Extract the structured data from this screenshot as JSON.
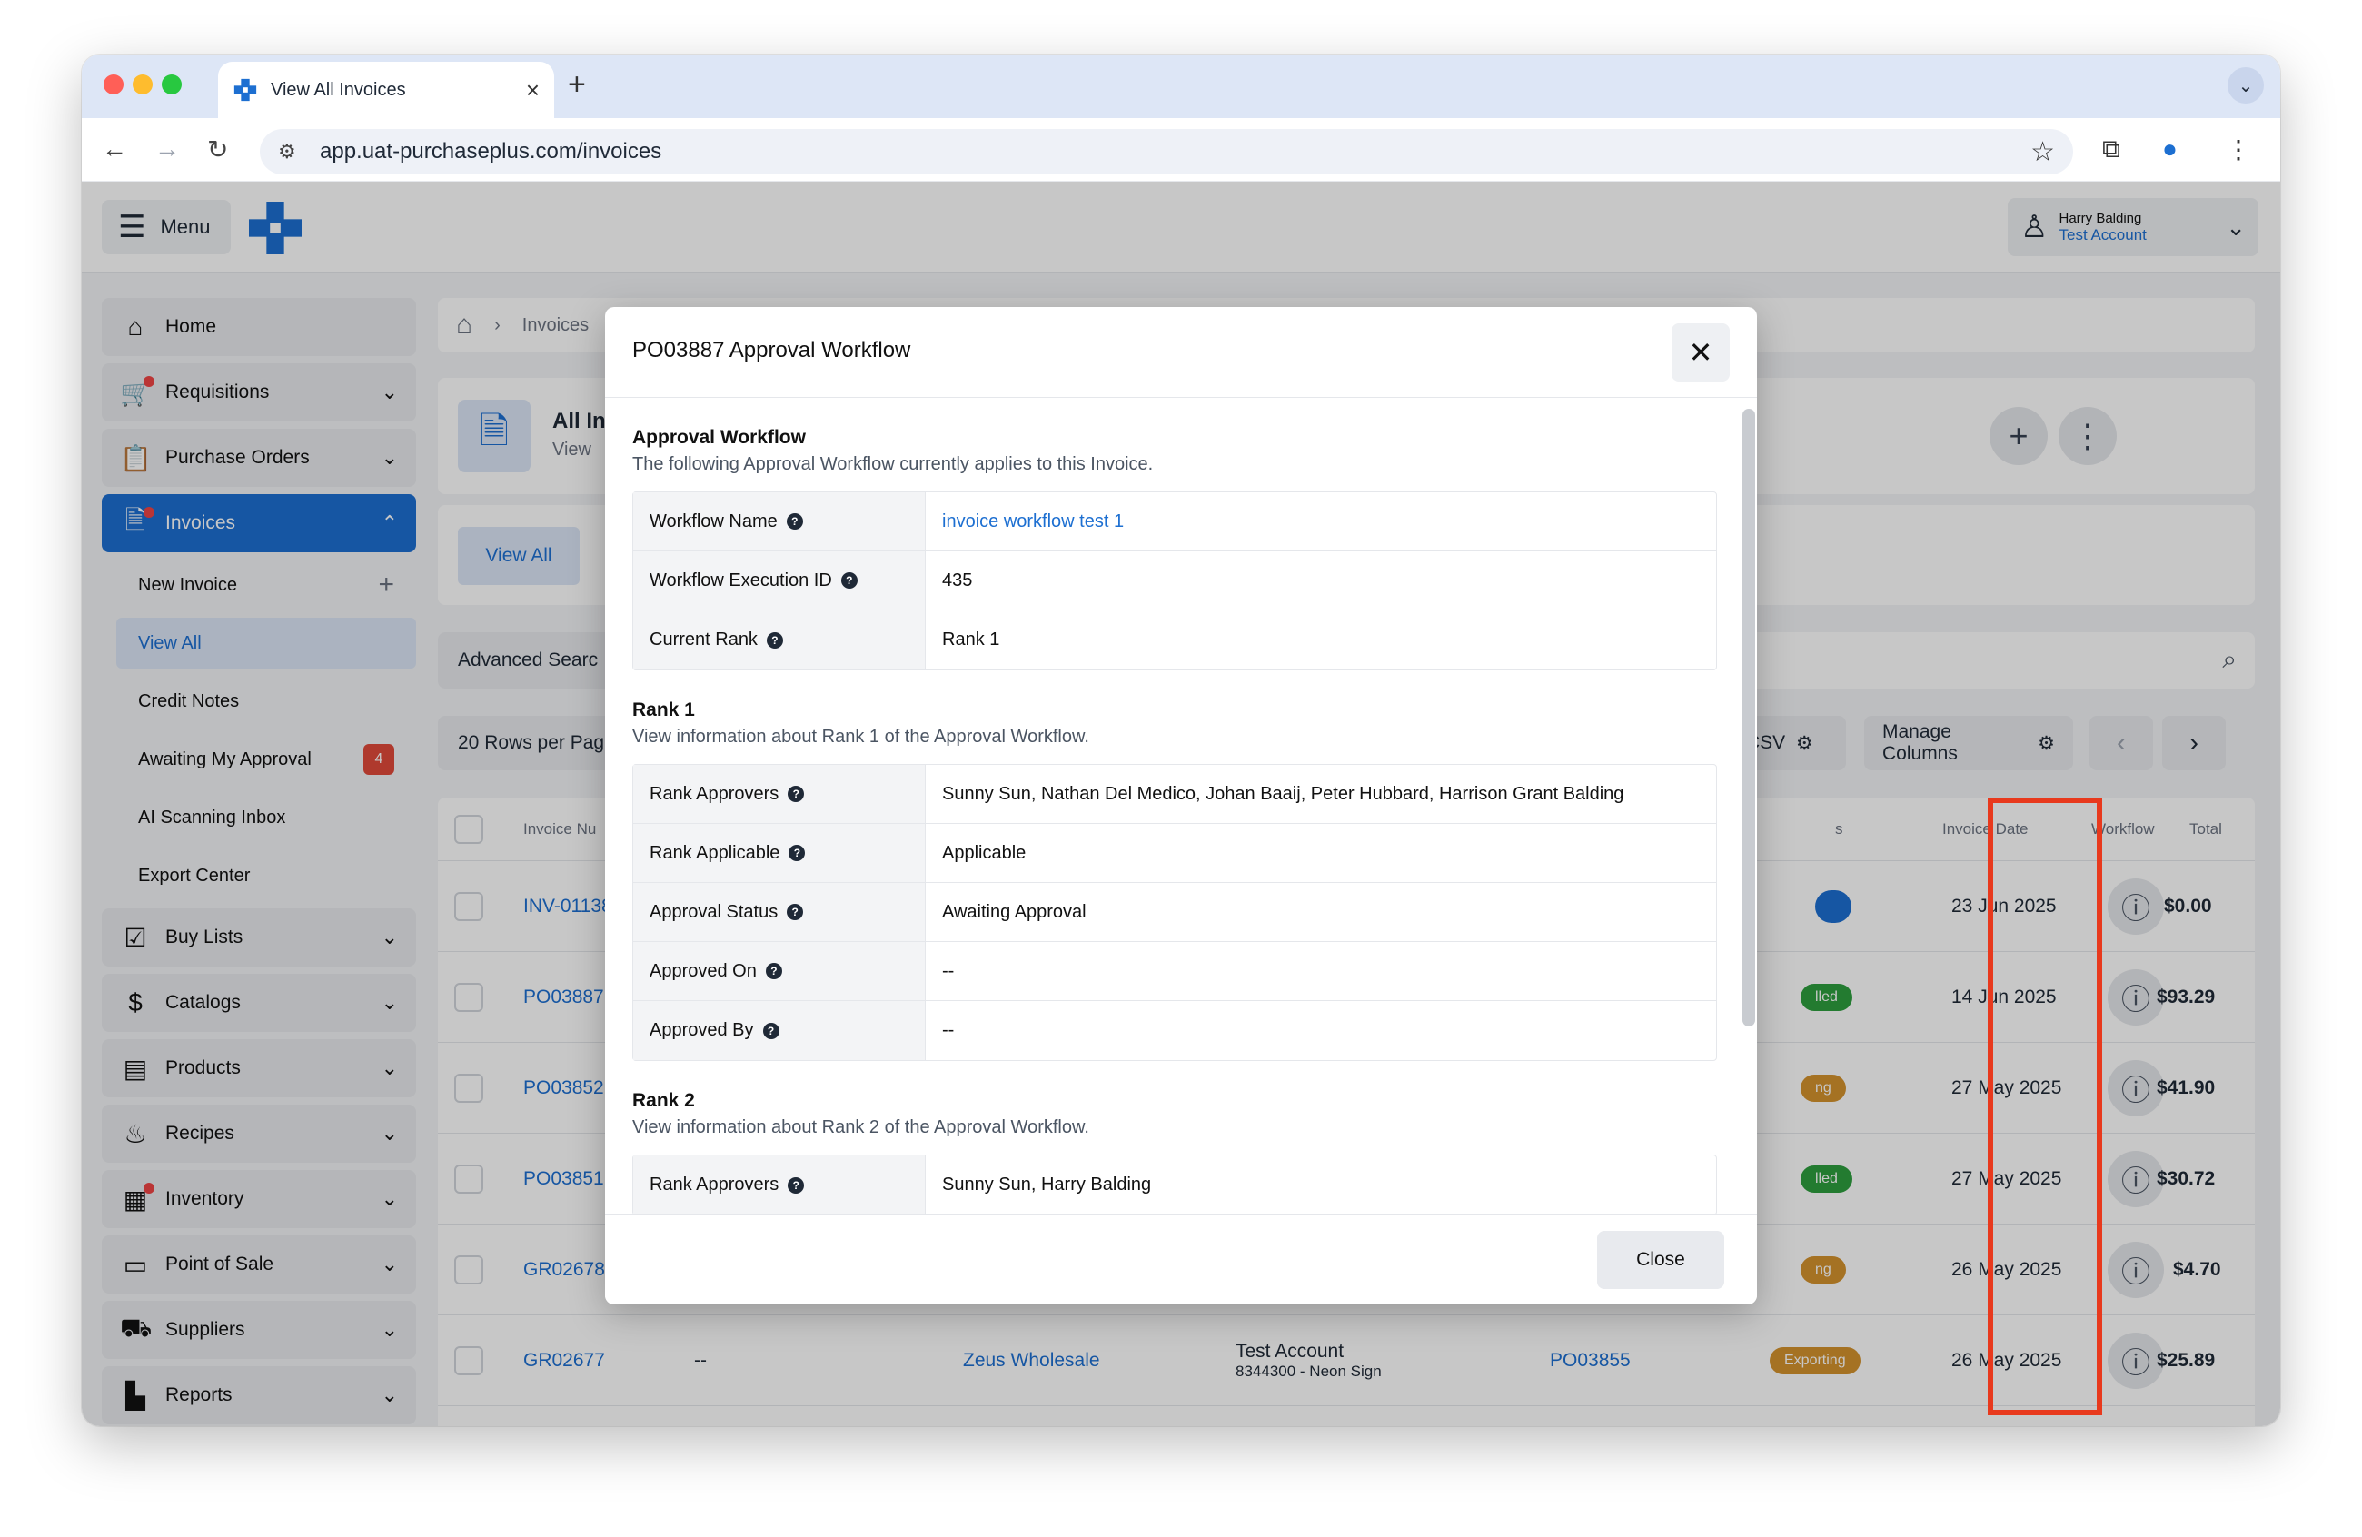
{
  "browser": {
    "tab_title": "View All Invoices",
    "url": "app.uat-purchaseplus.com/invoices"
  },
  "topbar": {
    "menu_label": "Menu",
    "user_name": "Harry Balding",
    "user_account": "Test Account"
  },
  "sidebar": {
    "items": [
      {
        "label": "Home",
        "icon": "home-icon"
      },
      {
        "label": "Requisitions",
        "icon": "cart-icon"
      },
      {
        "label": "Purchase Orders",
        "icon": "clipboard-icon"
      },
      {
        "label": "Invoices",
        "icon": "invoice-icon"
      },
      {
        "label": "Buy Lists",
        "icon": "checklist-icon"
      },
      {
        "label": "Catalogs",
        "icon": "dollar-doc-icon"
      },
      {
        "label": "Products",
        "icon": "box-icon"
      },
      {
        "label": "Recipes",
        "icon": "pot-icon"
      },
      {
        "label": "Inventory",
        "icon": "inventory-icon"
      },
      {
        "label": "Point of Sale",
        "icon": "card-icon"
      },
      {
        "label": "Suppliers",
        "icon": "truck-icon"
      },
      {
        "label": "Reports",
        "icon": "chart-icon"
      }
    ],
    "invoice_sub": [
      {
        "label": "New Invoice"
      },
      {
        "label": "View All"
      },
      {
        "label": "Credit Notes"
      },
      {
        "label": "Awaiting My Approval",
        "badge": "4"
      },
      {
        "label": "AI Scanning Inbox"
      },
      {
        "label": "Export Center"
      }
    ]
  },
  "main": {
    "breadcrumb": "Invoices",
    "page_title": "All In",
    "page_sub": "View",
    "tab_view_all": "View All",
    "advanced_search": "Advanced Searc",
    "rows_per_page": "20 Rows per Pag",
    "csv_label": "CSV",
    "manage_columns": "Manage Columns",
    "columns": {
      "invoice_no": "Invoice Nu",
      "status": "s",
      "invoice_date": "Invoice Date",
      "workflow": "Workflow",
      "total": "Total"
    },
    "rows": [
      {
        "invoice": "INV-01138",
        "status": "",
        "status_color": "#1d6fd1",
        "date": "23 Jun 2025",
        "total": "$0.00"
      },
      {
        "invoice": "PO03887",
        "status": "lled",
        "status_color": "#2e9e3e",
        "date": "14 Jun 2025",
        "total": "$93.29"
      },
      {
        "invoice": "PO03852",
        "status": "ng",
        "status_color": "#d4922e",
        "date": "27 May 2025",
        "total": "$41.90"
      },
      {
        "invoice": "PO03851",
        "status": "lled",
        "status_color": "#2e9e3e",
        "date": "27 May 2025",
        "total": "$30.72"
      },
      {
        "invoice": "GR02678",
        "status": "ng",
        "status_color": "#d4922e",
        "date": "26 May 2025",
        "total": "$4.70"
      },
      {
        "invoice": "GR02677",
        "ref": "--",
        "supplier": "Zeus Wholesale",
        "account": "Test Account",
        "account_sub": "8344300 - Neon Sign",
        "po": "PO03855",
        "status": "Exporting",
        "status_color": "#d4922e",
        "date": "26 May 2025",
        "total": "$25.89"
      }
    ]
  },
  "modal": {
    "title": "PO03887 Approval Workflow",
    "sections": [
      {
        "title": "Approval Workflow",
        "desc": "The following Approval Workflow currently applies to this Invoice.",
        "rows": [
          {
            "key": "Workflow Name",
            "value": "invoice workflow test 1",
            "link": true
          },
          {
            "key": "Workflow Execution ID",
            "value": "435"
          },
          {
            "key": "Current Rank",
            "value": "Rank 1"
          }
        ]
      },
      {
        "title": "Rank 1",
        "desc": "View information about Rank 1 of the Approval Workflow.",
        "rows": [
          {
            "key": "Rank Approvers",
            "value": "Sunny Sun, Nathan Del Medico, Johan Baaij, Peter Hubbard, Harrison Grant Balding"
          },
          {
            "key": "Rank Applicable",
            "value": "Applicable"
          },
          {
            "key": "Approval Status",
            "value": "Awaiting Approval"
          },
          {
            "key": "Approved On",
            "value": "--"
          },
          {
            "key": "Approved By",
            "value": "--"
          }
        ]
      },
      {
        "title": "Rank 2",
        "desc": "View information about Rank 2 of the Approval Workflow.",
        "rows": [
          {
            "key": "Rank Approvers",
            "value": "Sunny Sun, Harry Balding"
          }
        ]
      }
    ],
    "close_label": "Close",
    "help_glyph": "?"
  },
  "colors": {
    "accent": "#1d6fd1",
    "highlight": "#e8391d"
  }
}
